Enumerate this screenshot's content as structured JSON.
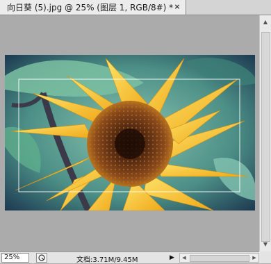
{
  "document": {
    "tab_title": "向日葵 (5).jpg @ 25% (图层 1, RGB/8#) *",
    "close_glyph": "×"
  },
  "statusbar": {
    "zoom": "25%",
    "doc_info": "文档:3.71M/9.45M",
    "play_glyph": "▶"
  },
  "icons": {
    "close": "close-icon",
    "info": "info-icon",
    "play": "play-arrow-icon"
  },
  "colors": {
    "canvas_bg": "#ababab",
    "petal": "#f7c12a",
    "disk": "#5a2d14",
    "leaf": "#5fae8c"
  }
}
